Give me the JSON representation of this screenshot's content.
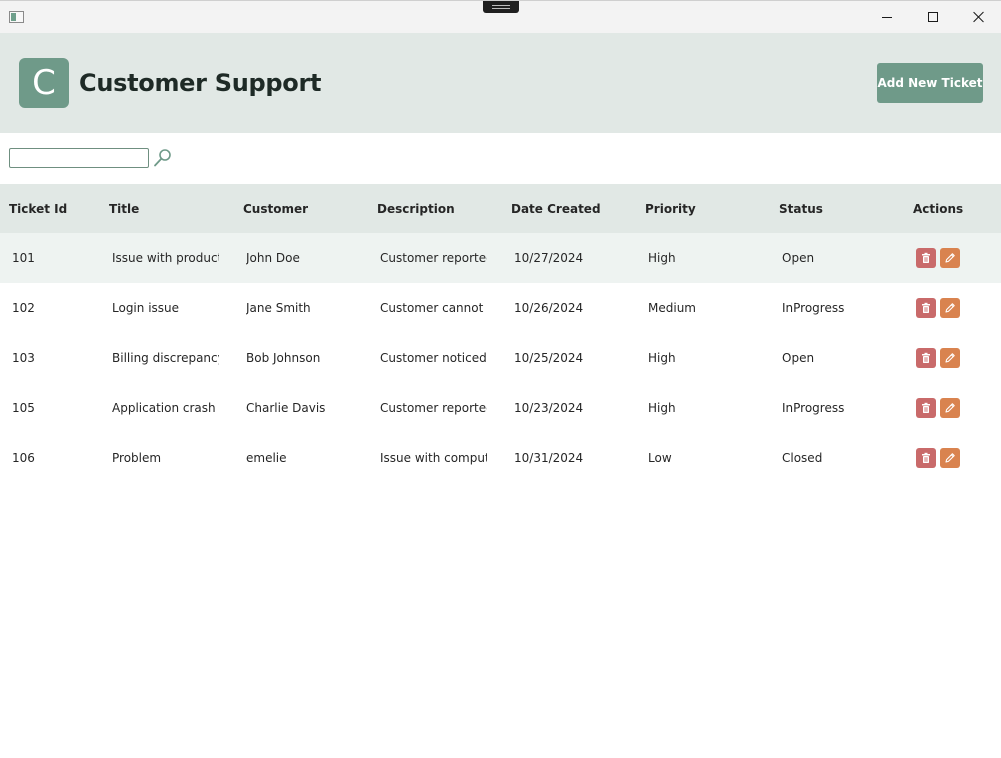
{
  "header": {
    "logo_letter": "C",
    "title": "Customer Support",
    "add_button_label": "Add New Ticket"
  },
  "search": {
    "value": "",
    "placeholder": ""
  },
  "table": {
    "columns": [
      "Ticket Id",
      "Title",
      "Customer",
      "Description",
      "Date Created",
      "Priority",
      "Status",
      "Actions"
    ],
    "rows": [
      {
        "id": "101",
        "title": "Issue with product d",
        "customer": "John Doe",
        "description": "Customer reported t",
        "date": "10/27/2024",
        "priority": "High",
        "status": "Open"
      },
      {
        "id": "102",
        "title": "Login issue",
        "customer": "Jane Smith",
        "description": "Customer cannot log",
        "date": "10/26/2024",
        "priority": "Medium",
        "status": "InProgress"
      },
      {
        "id": "103",
        "title": "Billing discrepancy",
        "customer": "Bob Johnson",
        "description": "Customer noticed ar",
        "date": "10/25/2024",
        "priority": "High",
        "status": "Open"
      },
      {
        "id": "105",
        "title": "Application crash on",
        "customer": "Charlie Davis",
        "description": "Customer reported t",
        "date": "10/23/2024",
        "priority": "High",
        "status": "InProgress"
      },
      {
        "id": "106",
        "title": "Problem",
        "customer": "emelie",
        "description": "Issue with computer",
        "date": "10/31/2024",
        "priority": "Low",
        "status": "Closed"
      }
    ],
    "row_actions": [
      {
        "name": "delete",
        "icon": "trash-icon",
        "color": "#c96a6a"
      },
      {
        "name": "edit",
        "icon": "pencil-icon",
        "color": "#d9834f"
      }
    ]
  },
  "colors": {
    "accent": "#6f9a89",
    "header_bg": "#e1e8e5",
    "alt_row_bg": "#eef3f1",
    "delete": "#c96a6a",
    "edit": "#d9834f"
  }
}
